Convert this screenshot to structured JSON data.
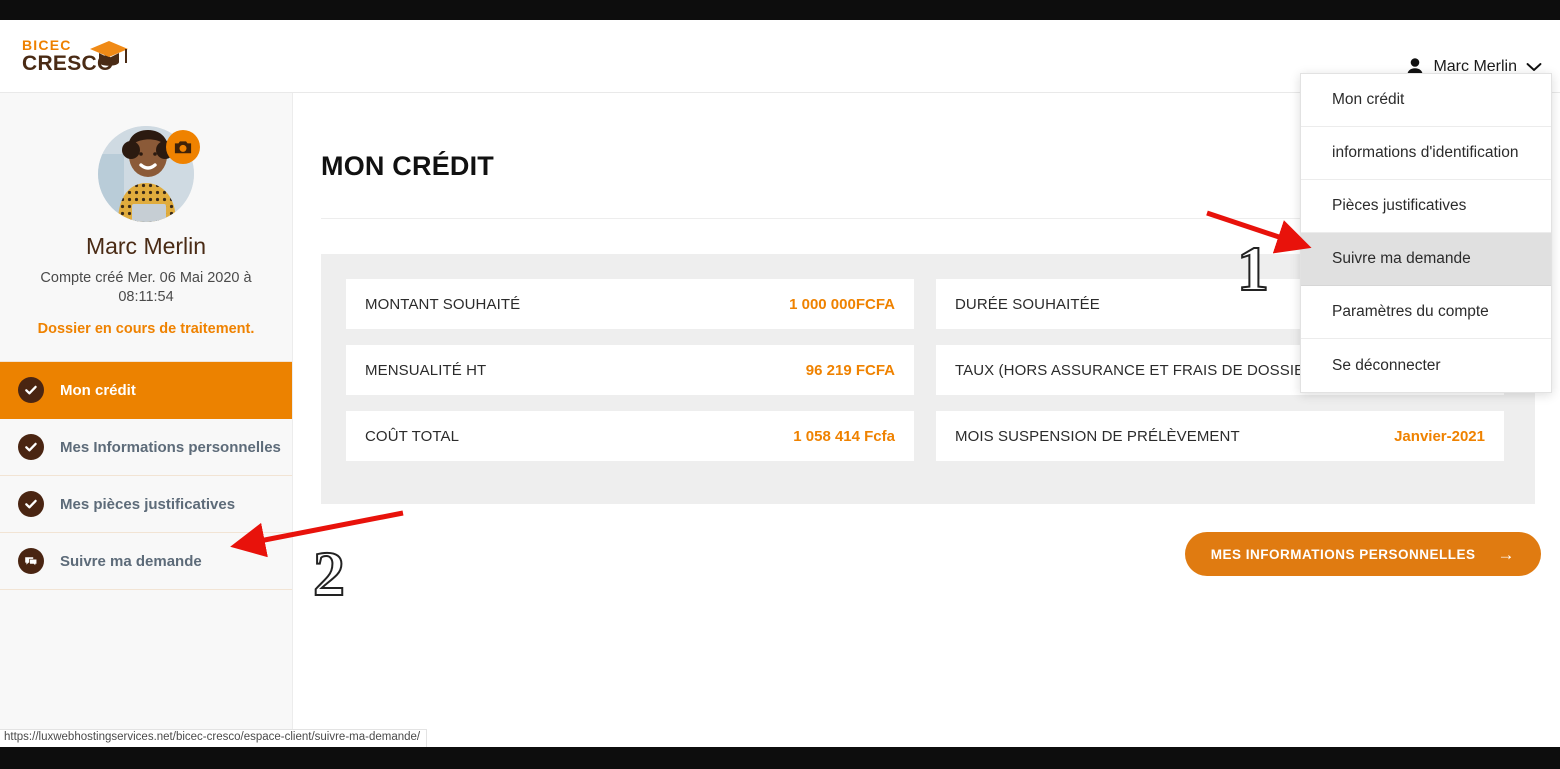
{
  "browser": {
    "status_url": "https://luxwebhostingservices.net/bicec-cresco/espace-client/suivre-ma-demande/"
  },
  "header": {
    "logo_line1": "BICEC",
    "logo_line2": "CRESCO",
    "user_name": "Marc Merlin",
    "user_icon": "person-icon",
    "chevron_icon": "chevron-down-icon"
  },
  "dropdown": {
    "items": [
      {
        "label": "Mon crédit",
        "active": false
      },
      {
        "label": "informations d'identification",
        "active": false
      },
      {
        "label": "Pièces justificatives",
        "active": false
      },
      {
        "label": "Suivre ma demande",
        "active": true
      },
      {
        "label": "Paramètres du compte",
        "active": false
      },
      {
        "label": "Se déconnecter",
        "active": false
      }
    ]
  },
  "sidebar": {
    "avatar_alt": "avatar-photo",
    "camera_badge_icon": "camera-icon",
    "profile_name": "Marc Merlin",
    "account_created": "Compte créé Mer. 06 Mai 2020 à 08:11:54",
    "status_text": "Dossier en cours de traitement.",
    "nav": [
      {
        "label": "Mon crédit",
        "icon": "check-circle-icon",
        "active": true
      },
      {
        "label": "Mes Informations personnelles",
        "icon": "check-circle-icon",
        "active": false
      },
      {
        "label": "Mes pièces justificatives",
        "icon": "check-circle-icon",
        "active": false
      },
      {
        "label": "Suivre ma demande",
        "icon": "chat-bubble-icon",
        "active": false
      }
    ]
  },
  "main": {
    "page_title": "MON CRÉDIT",
    "credit_rows_left": [
      {
        "label": "MONTANT SOUHAITÉ",
        "value": "1 000 000FCFA"
      },
      {
        "label": "MENSUALITÉ HT",
        "value": "96 219 FCFA"
      },
      {
        "label": "COÛT TOTAL",
        "value": "1 058 414 Fcfa"
      }
    ],
    "credit_rows_right": [
      {
        "label": "DURÉE SOUHAITÉE",
        "value": ""
      },
      {
        "label": "TAUX (HORS ASSURANCE ET FRAIS DE DOSSIER)",
        "value": ""
      },
      {
        "label": "MOIS SUSPENSION DE PRÉLÈVEMENT",
        "value": "Janvier-2021"
      }
    ],
    "cta_label": "MES INFORMATIONS PERSONNELLES",
    "cta_arrow": "→"
  },
  "annotations": [
    {
      "number": "1",
      "target": "dropdown-item-suivre-ma-demande"
    },
    {
      "number": "2",
      "target": "sidebar-item-suivre-ma-demande"
    }
  ],
  "colors": {
    "brand_orange": "#ef8200",
    "brand_brown": "#4a2b15",
    "panel_gray": "#eeeeee",
    "annotation_red": "#e8120b"
  }
}
